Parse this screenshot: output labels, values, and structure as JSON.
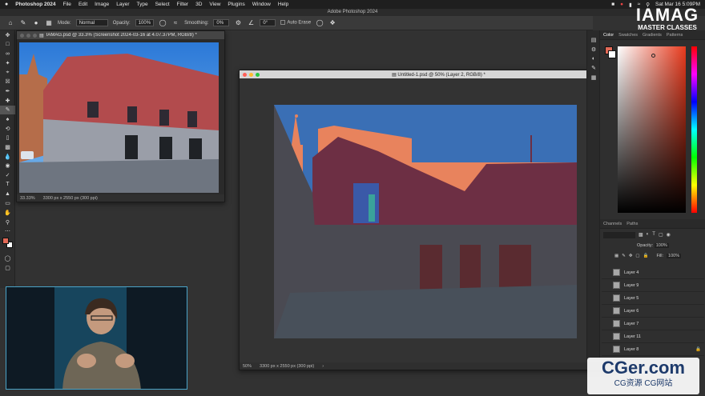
{
  "menubar": {
    "apple_icon": "apple-icon",
    "app_name": "Photoshop 2024",
    "items": [
      "File",
      "Edit",
      "Image",
      "Layer",
      "Type",
      "Select",
      "Filter",
      "3D",
      "View",
      "Plugins",
      "Window",
      "Help"
    ],
    "clock": "Sat Mar 16  5:09PM"
  },
  "window_title": "Adobe Photoshop 2024",
  "options": {
    "mode_label": "Mode:",
    "mode_value": "Normal",
    "opacity_label": "Opacity:",
    "opacity_value": "100%",
    "smoothing_label": "Smoothing:",
    "smoothing_value": "0%",
    "angle_value": "0°",
    "auto_erase_label": "Auto Erase"
  },
  "colors": {
    "foreground": "#e36a57",
    "background": "#ffffff",
    "sky": "#3a6fb5",
    "salmon": "#e8835d",
    "wall": "#6d2f44",
    "shadow": "#4a4a52",
    "ground": "#48505a"
  },
  "doc1": {
    "title": "IAMAG.psd @ 33.3% (Screenshot 2024-03-16 at 4.07.37PM, RGB/8) *",
    "zoom": "33.33%",
    "size": "3300 px x 2550 px (300 ppi)"
  },
  "doc2": {
    "title": "Untitled-1.psd @ 50% (Layer 2, RGB/8) *",
    "zoom": "50%",
    "size": "3300 px x 2550 px (300 ppi)"
  },
  "color_panel": {
    "tabs": [
      "Color",
      "Swatches",
      "Gradients",
      "Patterns"
    ]
  },
  "layers_panel": {
    "tabs": [
      "Channels",
      "Paths"
    ],
    "opacity_label": "Opacity:",
    "opacity_value": "100%",
    "fill_label": "Fill:",
    "fill_value": "100%",
    "layers": [
      "Layer 4",
      "Layer 9",
      "Layer 5",
      "Layer 6",
      "Layer 7",
      "Layer 11",
      "Layer 8"
    ]
  },
  "watermark": {
    "line1": "IAMAG",
    "line2": "MASTER CLASSES",
    "cger": "CGer.com",
    "cger_sub": "CG资源 CG网站"
  }
}
